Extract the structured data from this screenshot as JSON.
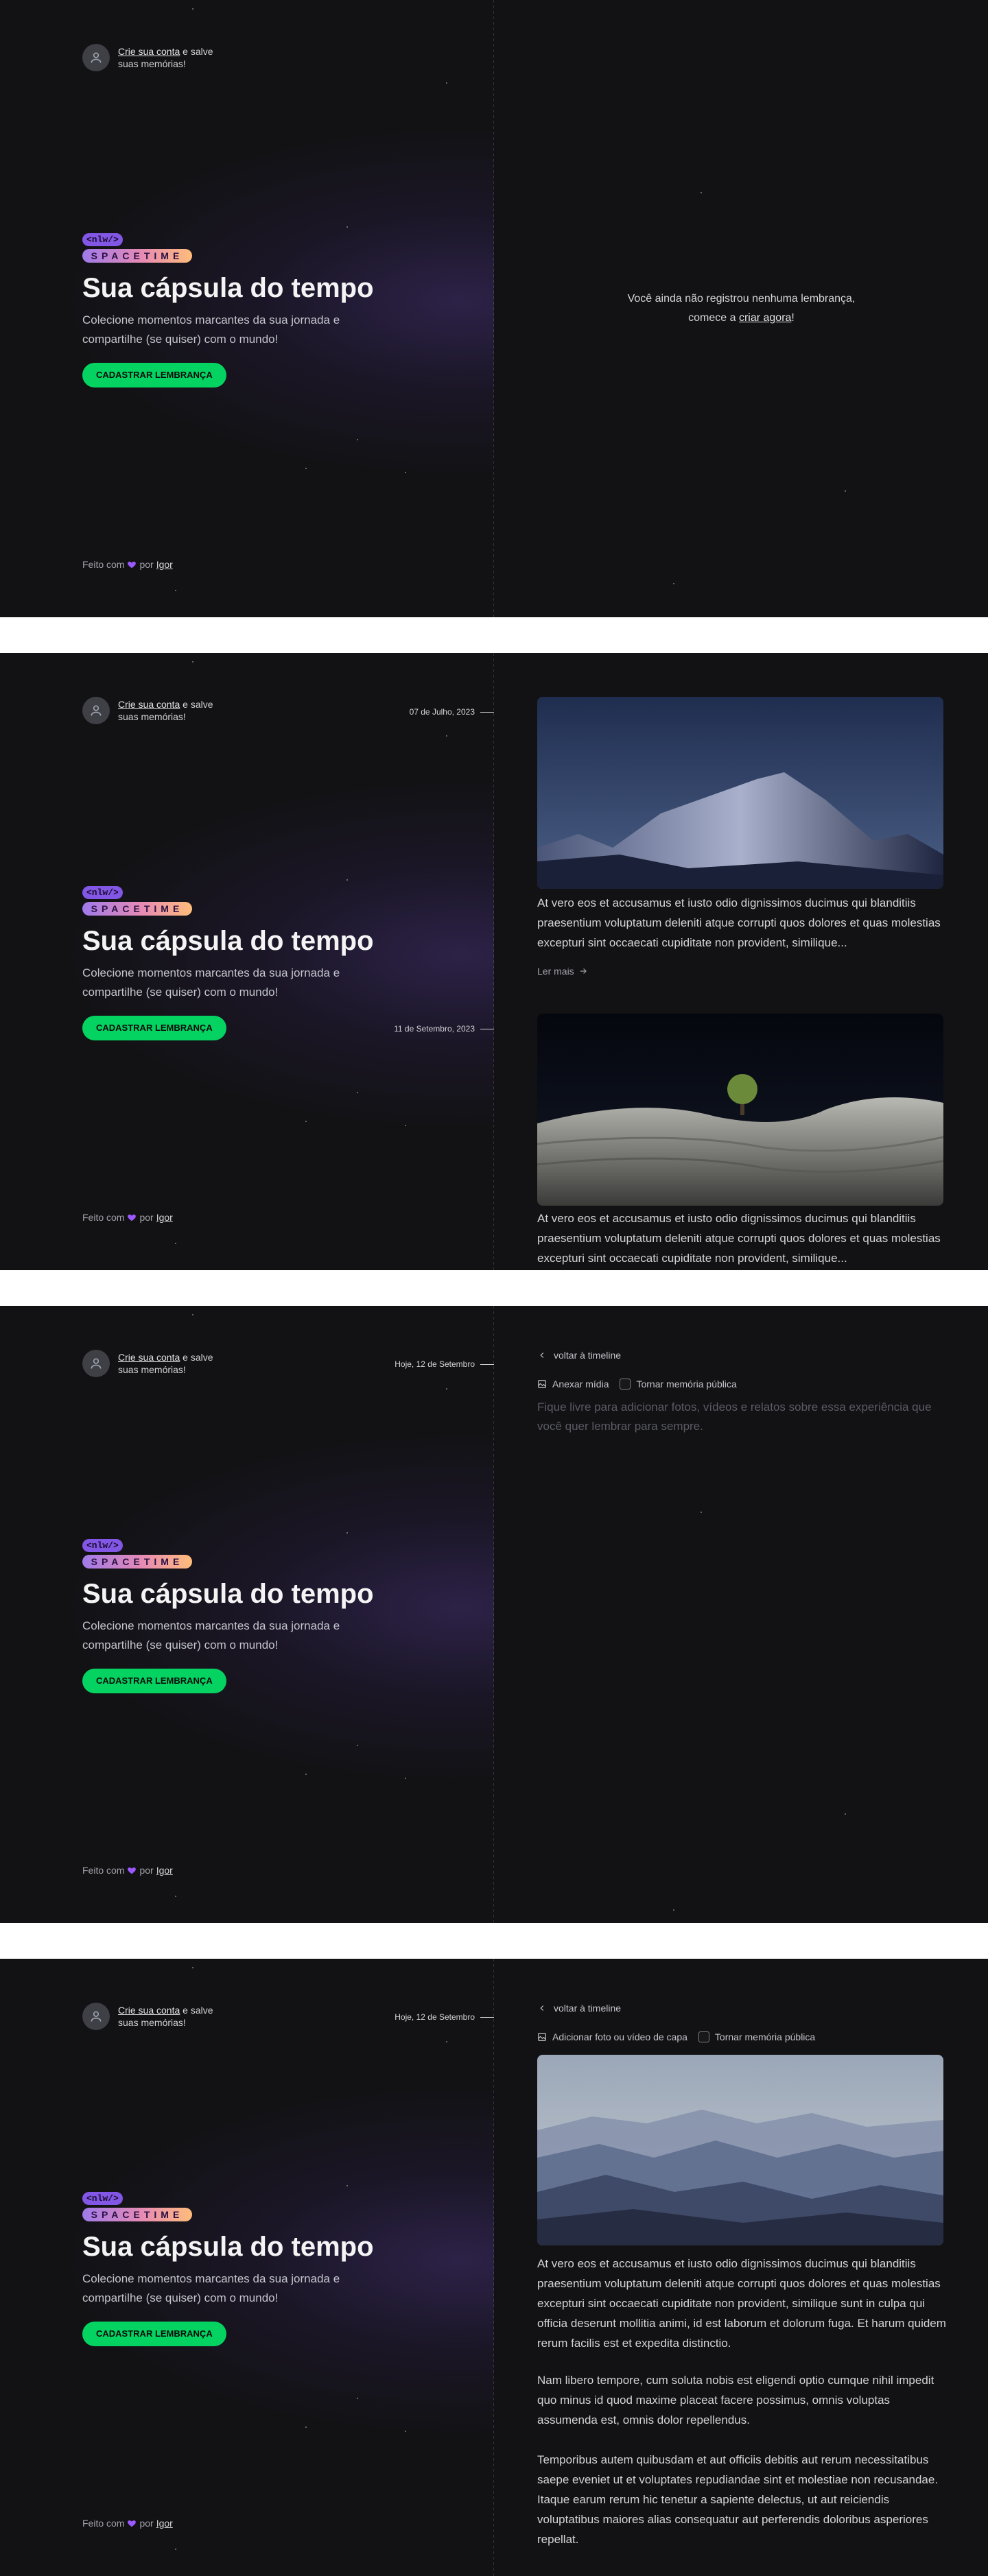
{
  "colors": {
    "background": "#121214",
    "accent_green": "#04d361",
    "accent_purple": "#8257e5",
    "text_muted": "#a1a1aa",
    "heart": "#9b59ff"
  },
  "sidebar": {
    "signup_link": "Crie sua conta",
    "signup_rest_1": "e salve",
    "signup_rest_2": "suas memórias!",
    "avatar_icon": "user-icon",
    "logo_nlw": "<nlw/>",
    "logo_spacetime": "SPACETIME",
    "title": "Sua cápsula do tempo",
    "description": "Colecione momentos marcantes da sua jornada e compartilhe (se quiser) com o mundo!",
    "cta_label": "CADASTRAR LEMBRANÇA",
    "footer_prefix": "Feito com",
    "footer_by": "por",
    "footer_author": "Igor",
    "heart_icon": "heart-icon"
  },
  "screen1": {
    "empty_line1": "Você ainda não registrou nenhuma lembrança,",
    "empty_prefix": "comece a",
    "empty_link": "criar agora",
    "empty_suffix": "!"
  },
  "screen2": {
    "memories": [
      {
        "date": "07 de Julho, 2023",
        "excerpt": "At vero eos et accusamus et iusto odio dignissimos ducimus qui blanditiis praesentium voluptatum deleniti atque corrupti quos dolores et quas molestias excepturi sint occaecati cupiditate non provident, similique...",
        "read_more": "Ler mais"
      },
      {
        "date": "11 de Setembro, 2023",
        "excerpt": "At vero eos et accusamus et iusto odio dignissimos ducimus qui blanditiis praesentium voluptatum deleniti atque corrupti quos dolores et quas molestias excepturi sint occaecati cupiditate non provident, similique..."
      }
    ]
  },
  "screen3": {
    "date": "Hoje, 12 de Setembro",
    "back_label": "voltar à timeline",
    "attach_label": "Anexar mídia",
    "public_label": "Tornar memória pública",
    "placeholder": "Fique livre para adicionar fotos, vídeos e relatos sobre essa experiência que você quer lembrar para sempre."
  },
  "screen4": {
    "date": "Hoje, 12 de Setembro",
    "back_label": "voltar à timeline",
    "cover_label": "Adicionar foto ou vídeo de capa",
    "public_label": "Tornar memória pública",
    "paragraphs": [
      "At vero eos et accusamus et iusto odio dignissimos ducimus qui blanditiis praesentium voluptatum deleniti atque corrupti quos dolores et quas molestias excepturi sint occaecati cupiditate non provident, similique sunt in culpa qui officia deserunt mollitia animi, id est laborum et dolorum fuga. Et harum quidem rerum facilis est et expedita distinctio.",
      "Nam libero tempore, cum soluta nobis est eligendi optio cumque nihil impedit quo minus id quod maxime placeat facere possimus, omnis voluptas assumenda est, omnis dolor repellendus.",
      "Temporibus autem quibusdam et aut officiis debitis aut rerum necessitatibus saepe eveniet ut et voluptates repudiandae sint et molestiae non recusandae. Itaque earum rerum hic tenetur a sapiente delectus, ut aut reiciendis voluptatibus maiores alias consequatur aut perferendis doloribus asperiores repellat."
    ]
  }
}
